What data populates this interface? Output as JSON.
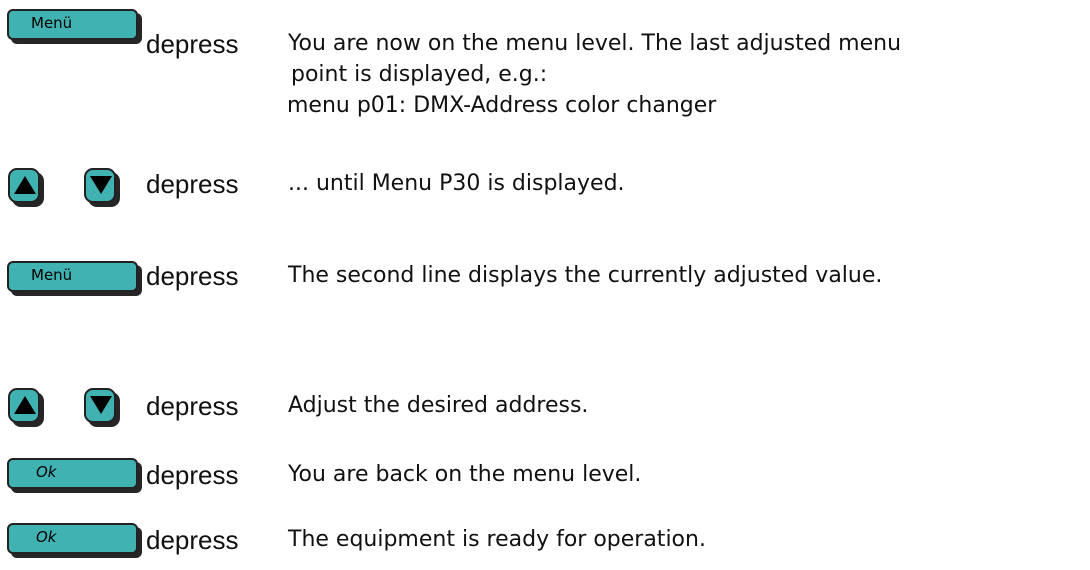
{
  "steps": [
    {
      "key": "Menü",
      "action": "depress",
      "lines": [
        "You are now on the menu level. The last adjusted menu",
        "point is displayed, e.g.:",
        "menu p01: DMX-Address color changer"
      ]
    },
    {
      "keys": [
        "arrow-up",
        "arrow-down"
      ],
      "action": "depress",
      "lines": [
        "... until Menu P30 is displayed."
      ]
    },
    {
      "key": "Menü",
      "action": "depress",
      "lines": [
        "The second line displays the currently adjusted value."
      ]
    },
    {
      "keys": [
        "arrow-up",
        "arrow-down"
      ],
      "action": "depress",
      "lines": [
        "Adjust the desired address."
      ]
    },
    {
      "key": "Ok",
      "action": "depress",
      "lines": [
        "You are back on the menu level."
      ]
    },
    {
      "key": "Ok",
      "action": "depress",
      "lines": [
        "The equipment is ready for operation."
      ]
    }
  ],
  "colors": {
    "key_fill": "#41b2b2",
    "key_border": "#222222",
    "key_shadow": "#262626"
  }
}
